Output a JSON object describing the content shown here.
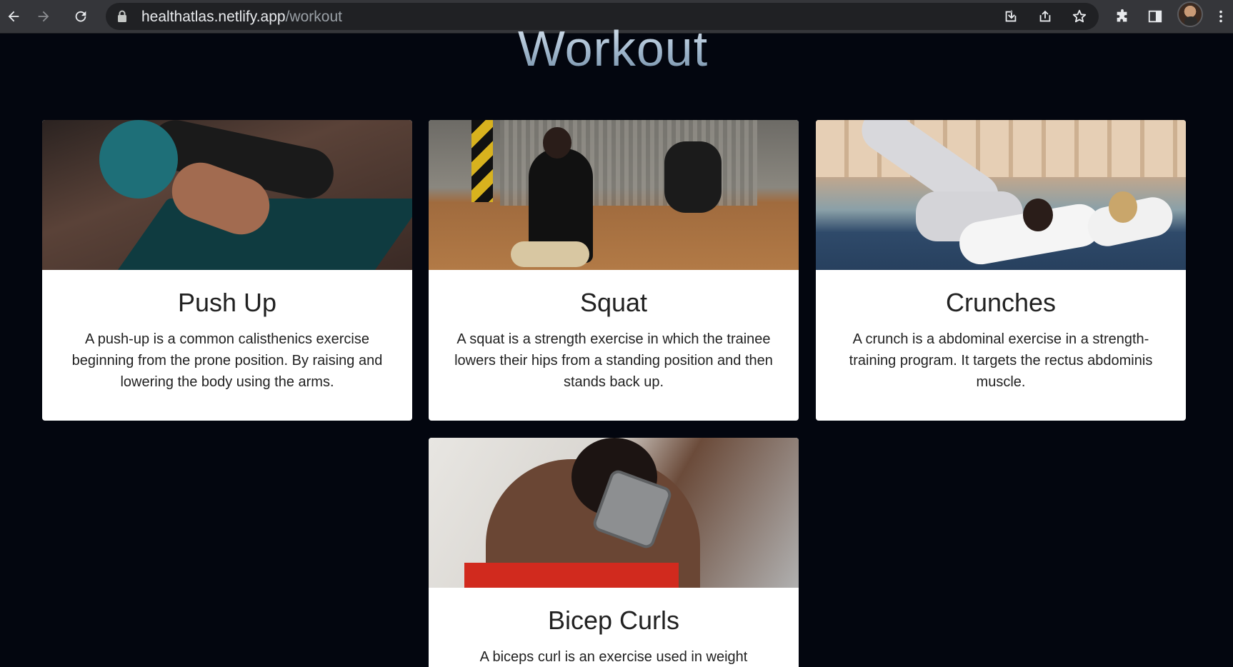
{
  "browser": {
    "url_host": "healthatlas.netlify.app",
    "url_path": "/workout"
  },
  "page": {
    "title": "Workout"
  },
  "cards": [
    {
      "title": "Push Up",
      "description": "A push-up is a common calisthenics exercise beginning from the prone position. By raising and lowering the body using the arms."
    },
    {
      "title": "Squat",
      "description": "A squat is a strength exercise in which the trainee lowers their hips from a standing position and then stands back up."
    },
    {
      "title": "Crunches",
      "description": "A crunch is a abdominal exercise in a strength-training program. It targets the rectus abdominis muscle."
    },
    {
      "title": "Bicep Curls",
      "description": "A biceps curl is an exercise used in weight"
    }
  ]
}
